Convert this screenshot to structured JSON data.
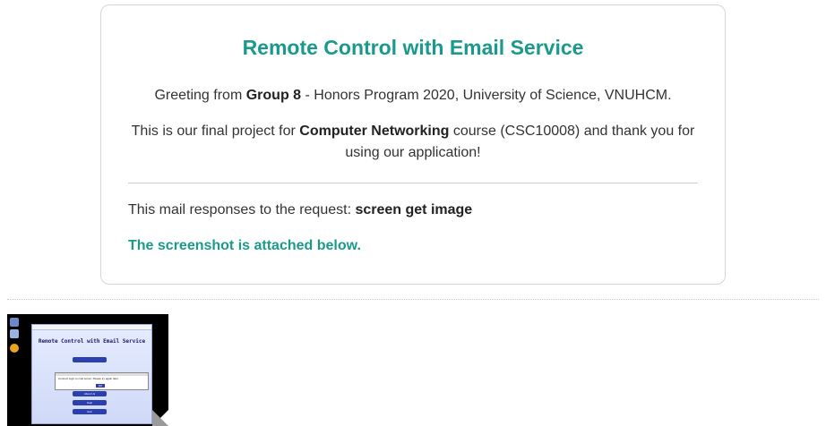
{
  "email": {
    "title": "Remote Control with Email Service",
    "greeting_prefix": "Greeting from ",
    "group": "Group 8",
    "greeting_suffix": " - Honors Program 2020, University of Science, VNUHCM.",
    "project_prefix": "This is our final project for ",
    "course": "Computer Networking",
    "project_suffix": " course (CSC10008) and thank you for using our application!",
    "request_prefix": "This mail responses to the request: ",
    "request": "screen get image",
    "attached_note": "The screenshot is attached below."
  },
  "attachment": {
    "thumbnail_app_title": "Remote Control with Email Service",
    "dialog_text": "Connect login to mail server. Please try again later.",
    "buttons": [
      "OK",
      "About Us",
      "Help",
      "Exit"
    ]
  },
  "colors": {
    "accent": "#1b9a8c",
    "text": "#333333",
    "border": "#d6d6d6"
  }
}
